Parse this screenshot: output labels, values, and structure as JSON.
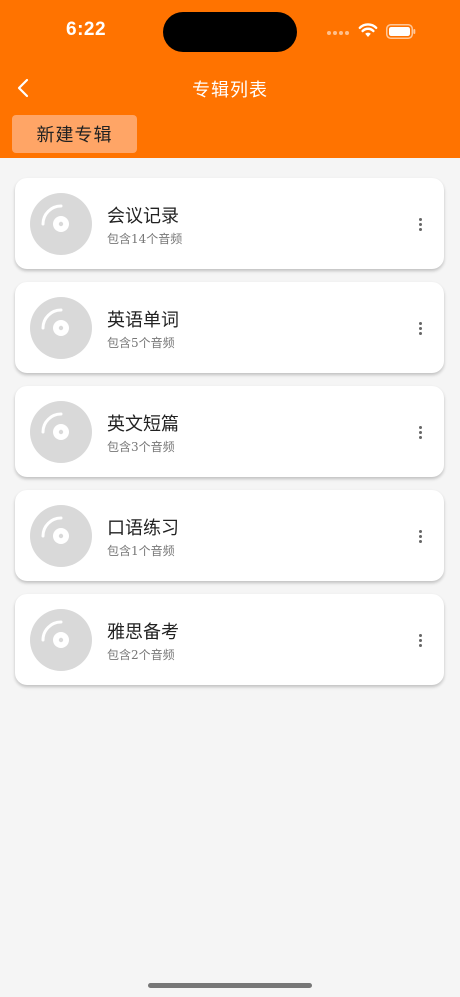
{
  "status_bar": {
    "time": "6:22",
    "wifi_icon": "wifi-icon",
    "battery_icon": "battery-icon"
  },
  "nav": {
    "back_icon": "chevron-left-icon",
    "title": "专辑列表"
  },
  "toolbar": {
    "new_album_label": "新建专辑"
  },
  "albums": [
    {
      "name": "会议记录",
      "count": "包含14个音频",
      "icon": "disc-icon",
      "menu_icon": "more-vertical-icon"
    },
    {
      "name": "英语单词",
      "count": "包含5个音频",
      "icon": "disc-icon",
      "menu_icon": "more-vertical-icon"
    },
    {
      "name": "英文短篇",
      "count": "包含3个音频",
      "icon": "disc-icon",
      "menu_icon": "more-vertical-icon"
    },
    {
      "name": "口语练习",
      "count": "包含1个音频",
      "icon": "disc-icon",
      "menu_icon": "more-vertical-icon"
    },
    {
      "name": "雅思备考",
      "count": "包含2个音频",
      "icon": "disc-icon",
      "menu_icon": "more-vertical-icon"
    }
  ],
  "colors": {
    "header": "#ff7300",
    "button": "#ffa566",
    "background": "#f5f5f5",
    "disc": "#d9d9d9"
  }
}
